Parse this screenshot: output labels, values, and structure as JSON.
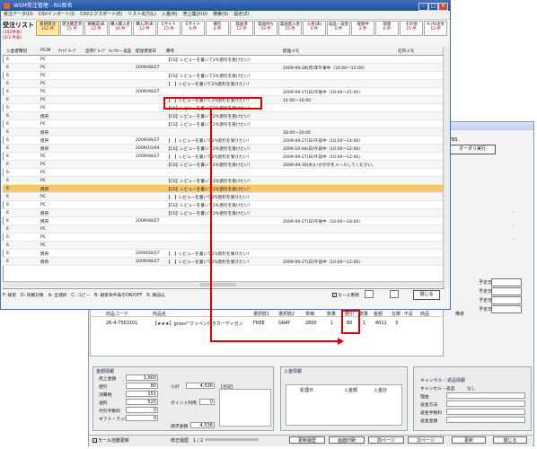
{
  "back": {
    "right_label": "TBS",
    "right_button": "オーダリ実行",
    "yotei_labels": [
      "予定日",
      "予定日",
      "予定日",
      "予定日"
    ],
    "grid_headers": [
      "商品コード",
      "商品名",
      "選択肢1",
      "選択肢2",
      "単価",
      "数量",
      "値引",
      "数量",
      "金額",
      "在庫",
      "不足",
      "商品",
      "備考"
    ],
    "grid_row": [
      "26-4-7563101",
      "【★★★】gross* ワッペン付きカーディガン",
      "FREE",
      "GRAY",
      "2800",
      "1",
      "80",
      "1",
      "4011",
      "3"
    ],
    "amount_title": "金額情報",
    "amount_items": [
      {
        "label": "売上金額",
        "value": "3,900"
      },
      {
        "label": "値引",
        "value": "80"
      },
      {
        "label": "消費税",
        "value": "151"
      },
      {
        "label": "送料",
        "value": "525"
      },
      {
        "label": "代引手数料",
        "value": "0"
      },
      {
        "label": "ギフト・ラッピン",
        "value": "0"
      }
    ],
    "subtotal_label": "小計",
    "subtotal_value": "4,536",
    "point_label": "ポイント利用",
    "point_value": "0",
    "billing_label": "請求金額",
    "billing_value": "4,536",
    "memo_label": "[注記]",
    "deposit_title": "入金情報",
    "deposit_headers": [
      "処理日",
      "入金額",
      "入金計"
    ],
    "cancel_title": "キャンセル・返品情報",
    "cancel_items": [
      {
        "label": "キャンセル・返品",
        "value": "なし"
      },
      {
        "label": "理由",
        "value": ""
      },
      {
        "label": "返金方法",
        "value": ""
      },
      {
        "label": "返金手数料",
        "value": ""
      },
      {
        "label": "返金金額",
        "value": ""
      }
    ],
    "auto_update": "モール自動更新",
    "edit_history": "修正履歴　1 / 2",
    "bottom_buttons": [
      "更新履歴",
      "画面印刷",
      "前ページ",
      "次ページ",
      "更新",
      "閉じる"
    ]
  },
  "front": {
    "title": "WSM受注管理 - RG新名",
    "menu": [
      "受注データ(D)",
      "CSVインポート(I)",
      "CSVエクスポート(E)",
      "リスト出力(L)",
      "入金(N)",
      "売上集計(U)",
      "検索(S)",
      "設定(Z)"
    ],
    "list_title": "受注リスト",
    "list_counts": [
      "(102件表)",
      "(2/3 件表)"
    ],
    "folder_tabs": [
      {
        "name": "新規受注",
        "count": "102 件"
      },
      {
        "name": "受注確定済",
        "count": "15 件"
      },
      {
        "name": "要確認(未",
        "count": "12 件"
      },
      {
        "name": "購入確入金",
        "count": "26 件"
      },
      {
        "name": "購入済(未",
        "count": "12 件"
      },
      {
        "name": "Eサイト",
        "count": "15 件"
      },
      {
        "name": "Eサイト",
        "count": "6 件"
      },
      {
        "name": "梱包",
        "count": "4 件"
      },
      {
        "name": "発送済",
        "count": "12 件"
      },
      {
        "name": "発送待ち",
        "count": "33 件"
      },
      {
        "name": "発送進入金",
        "count": "15 件"
      },
      {
        "name": "入金(未)",
        "count": "0 件"
      },
      {
        "name": "返品・返金",
        "count": "0 件"
      },
      {
        "name": "保留中",
        "count": "2 件"
      },
      {
        "name": "保留",
        "count": "0 件"
      },
      {
        "name": "その他",
        "count": "15 件"
      },
      {
        "name": "ｷｬﾝｾﾙ注文",
        "count": "12 件"
      }
    ],
    "columns": [
      "入金者種別",
      "PC/M",
      "ｻｲﾄｸﾞﾙｰﾌﾟ",
      "出荷ｸﾞﾙｰﾌﾟ",
      "ｷｬﾝｾﾙ・返品",
      "配送者受日",
      "備考",
      "配送メモ",
      "社内メモ"
    ],
    "rows": [
      {
        "n": "6",
        "pc": "PC",
        "date": "",
        "biko": "【CS】レビューを書いて2％割引を受けたい！",
        "memo": ""
      },
      {
        "n": "6",
        "pc": "PC",
        "date": "2009/08/27",
        "biko": "",
        "memo": "2009-09-28(月)年午後中（10:00〜12:00）"
      },
      {
        "n": "6",
        "pc": "PC",
        "date": "",
        "biko": "【CS】レビューを書いて2％割引を受けたい！",
        "memo": ""
      },
      {
        "n": "6",
        "pc": "PC",
        "date": "",
        "biko": "【　】レビューを書いて2％割引を受けたい！",
        "memo": ""
      },
      {
        "n": "6",
        "pc": "PC",
        "date": "2009/08/27",
        "biko": "",
        "memo": "2009-09-27(日)午後中（16:00〜21:00）"
      },
      {
        "n": "6",
        "pc": "PC",
        "date": "",
        "biko": "【　】レビューを書いて2％割引を受けたい！",
        "memo": "14:00〜16:00"
      },
      {
        "n": "6",
        "pc": "PC",
        "date": "",
        "biko": "【CS】レビューを書いて2％割引を受けたい！",
        "memo": ""
      },
      {
        "n": "6",
        "pc": "携帯",
        "date": "",
        "biko": "【CS】レビューを書いて2％割引を受けたい！",
        "memo": ""
      },
      {
        "n": "6",
        "pc": "PC",
        "date": "",
        "biko": "【CS】レビューを書いて2％割引を受けたい！",
        "memo": ""
      },
      {
        "n": "6",
        "pc": "携帯",
        "date": "",
        "biko": "",
        "memo": "18:00〜20:00"
      },
      {
        "n": "6",
        "pc": "携帯",
        "date": "2009/08/27",
        "biko": "【　】レビューを書いて2％割引を受けたい！",
        "memo": "2009-09-27(日)午前中（10:00〜14:00）"
      },
      {
        "n": "6",
        "pc": "携帯",
        "date": "2009/10/04",
        "biko": "【CS】レビューを書いて2％割引を受けたい！",
        "memo": "2009-10-04(日)午前中（10:00〜12:00）"
      },
      {
        "n": "6",
        "pc": "PC",
        "date": "2009/08/27",
        "biko": "【　】レビューを書いて2％割引を受けたい！",
        "memo": "2009-09-27(日)午前中（10:00〜12:00）"
      },
      {
        "n": "6",
        "pc": "PC",
        "date": "",
        "biko": "【CS】レビューを書いて2％割引を受けたい！",
        "memo": "2009-09-30(水)いかがかをメールしてください。"
      },
      {
        "n": "6",
        "pc": "PC",
        "date": "",
        "biko": "",
        "memo": ""
      },
      {
        "n": "6",
        "pc": "PC",
        "date": "",
        "biko": "【CS】レビューを書いて2％割引を受けたい！",
        "memo": ""
      },
      {
        "n": "6",
        "pc": "携帯",
        "date": "",
        "biko": "【CS】レビューを書いて2％割引を受けたい！",
        "memo": ""
      },
      {
        "n": "6",
        "pc": "PC",
        "date": "",
        "biko": "【　】レビューを書いて2％割引を受けたい！",
        "memo": ""
      },
      {
        "n": "6",
        "pc": "PC",
        "date": "",
        "biko": "【CS】レビューを書いて2％割引を受けたい！",
        "memo": ""
      },
      {
        "n": "6",
        "pc": "携帯",
        "date": "",
        "biko": "【CS】レビューを書いて2％割引を受けたい！",
        "memo": ""
      },
      {
        "n": "6",
        "pc": "携帯",
        "date": "2009/08/27",
        "biko": "",
        "memo": "2009-09-27(日)午後中（16:00〜18:00）"
      },
      {
        "n": "6",
        "pc": "PC",
        "date": "",
        "biko": "",
        "memo": ""
      },
      {
        "n": "6",
        "pc": "PC",
        "date": "",
        "biko": "",
        "memo": ""
      },
      {
        "n": "6",
        "pc": "PC",
        "date": "",
        "biko": "",
        "memo": ""
      },
      {
        "n": "6",
        "pc": "携帯",
        "date": "2009/08/27",
        "biko": "【　】レビューを書いて2％割引を受けたい！",
        "memo": ""
      },
      {
        "n": "6",
        "pc": "携帯",
        "date": "2009/08/27",
        "biko": "【　】レビューを書いて2％割引を受けたい！",
        "memo": "2009-09-27(日)午前中（10:00〜12:00）"
      }
    ],
    "status_text": "F: 検索　D: 同機対象　A: 全選択　C: コピー　B: 検索条件表示ON/OFF　R: 再読込",
    "model_update": "モール更新",
    "close_button": "閉じる"
  },
  "colors": {
    "highlight_row": "#f5c86a",
    "red_marker": "#e00000",
    "title_bar": "#2d5fb2"
  }
}
